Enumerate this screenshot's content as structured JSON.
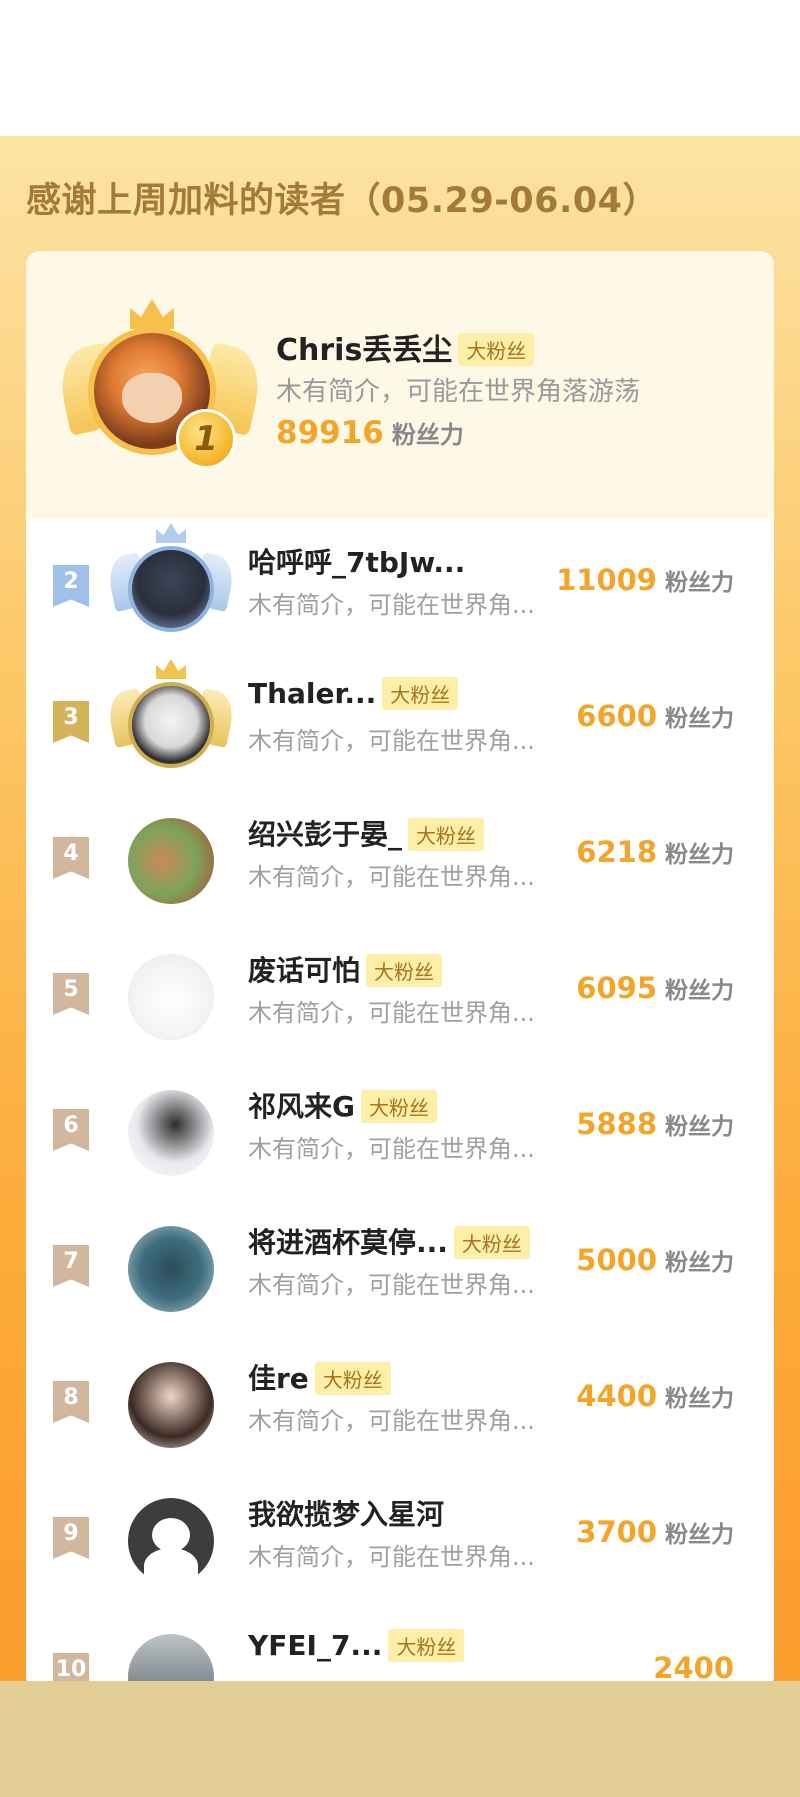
{
  "title": "感谢上周加料的读者（05.29-06.04）",
  "fan_unit": "粉丝力",
  "tag_label": "大粉丝",
  "champion": {
    "rank": "1",
    "name": "Chris丢丢尘",
    "tag": "大粉丝",
    "intro": "木有简介，可能在世界角落游荡",
    "score": "89916",
    "unit": "粉丝力"
  },
  "rows": [
    {
      "rank": "2",
      "name": "哈呼呼_7tbJw...",
      "tag": "",
      "intro": "木有简介，可能在世界角...",
      "score": "11009",
      "unit": "粉丝力"
    },
    {
      "rank": "3",
      "name": "Thaler...",
      "tag": "大粉丝",
      "intro": "木有简介，可能在世界角...",
      "score": "6600",
      "unit": "粉丝力"
    },
    {
      "rank": "4",
      "name": "绍兴彭于晏_",
      "tag": "大粉丝",
      "intro": "木有简介，可能在世界角...",
      "score": "6218",
      "unit": "粉丝力"
    },
    {
      "rank": "5",
      "name": "废话可怕",
      "tag": "大粉丝",
      "intro": "木有简介，可能在世界角...",
      "score": "6095",
      "unit": "粉丝力"
    },
    {
      "rank": "6",
      "name": "祁风来G",
      "tag": "大粉丝",
      "intro": "木有简介，可能在世界角...",
      "score": "5888",
      "unit": "粉丝力"
    },
    {
      "rank": "7",
      "name": "将进酒杯莫停...",
      "tag": "大粉丝",
      "intro": "木有简介，可能在世界角...",
      "score": "5000",
      "unit": "粉丝力"
    },
    {
      "rank": "8",
      "name": "佳re",
      "tag": "大粉丝",
      "intro": "木有简介，可能在世界角...",
      "score": "4400",
      "unit": "粉丝力"
    },
    {
      "rank": "9",
      "name": "我欲揽梦入星河",
      "tag": "",
      "intro": "木有简介，可能在世界角...",
      "score": "3700",
      "unit": "粉丝力"
    },
    {
      "rank": "10",
      "name": "YFEI_7...",
      "tag": "大粉丝",
      "intro": "",
      "score": "2400",
      "unit": ""
    }
  ],
  "colors": {
    "accent_score": "#f3a52a",
    "rank2_flag": "#9fc0e8",
    "rank3_flag": "#d4b45a",
    "rank_default_flag": "#d2b79e",
    "tag_bg": "#fdefa7",
    "tag_text": "#a8731e"
  },
  "avatar_icons": {
    "rank2": "avatar-photo-icon",
    "rank5": "cartoon-cat-avatar-icon",
    "rank9": "default-avatar-icon"
  }
}
